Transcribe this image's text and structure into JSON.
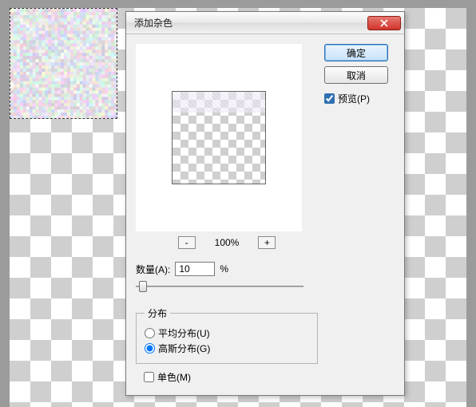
{
  "dialog": {
    "title": "添加杂色",
    "ok_label": "确定",
    "cancel_label": "取消",
    "preview_label": "预览(P)",
    "preview_checked": true,
    "zoom": {
      "out_label": "-",
      "value": "100%",
      "in_label": "+"
    },
    "amount": {
      "label": "数量(A):",
      "value": "10",
      "unit": "%"
    },
    "distribution": {
      "legend": "分布",
      "uniform_label": "平均分布(U)",
      "gaussian_label": "高斯分布(G)",
      "selected": "gaussian"
    },
    "monochrome": {
      "label": "单色(M)",
      "checked": false
    }
  }
}
